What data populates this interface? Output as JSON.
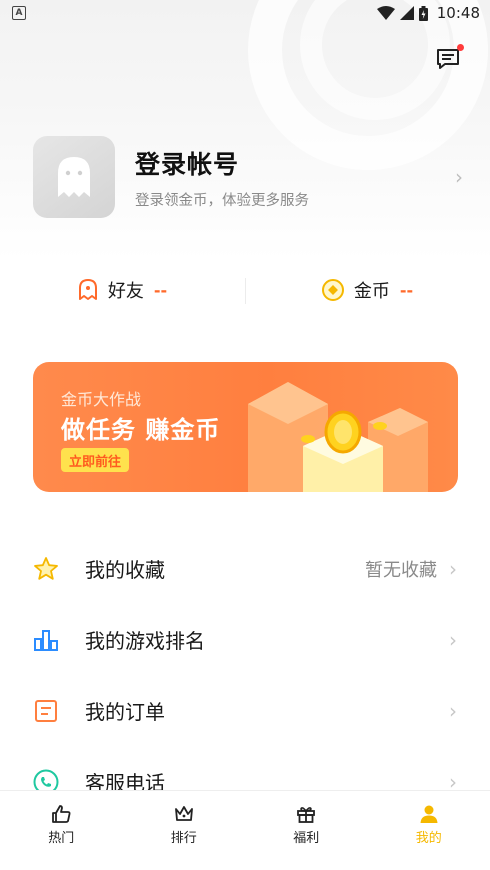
{
  "status_bar": {
    "time": "10:48",
    "badge": "A"
  },
  "profile": {
    "title": "登录帐号",
    "subtitle": "登录领金币，体验更多服务"
  },
  "stats": [
    {
      "label": "好友",
      "value": "--",
      "icon": "ghost-friend-icon"
    },
    {
      "label": "金币",
      "value": "--",
      "icon": "coin-icon"
    }
  ],
  "banner": {
    "small": "金币大作战",
    "big": "做任务 赚金币",
    "button": "立即前往"
  },
  "menu": [
    {
      "label": "我的收藏",
      "right": "暂无收藏",
      "icon": "star-icon"
    },
    {
      "label": "我的游戏排名",
      "right": "",
      "icon": "bar-chart-icon"
    },
    {
      "label": "我的订单",
      "right": "",
      "icon": "order-icon"
    },
    {
      "label": "客服电话",
      "right": "",
      "icon": "phone-icon"
    }
  ],
  "nav": [
    {
      "label": "热门",
      "icon": "thumbs-up-icon",
      "active": false
    },
    {
      "label": "排行",
      "icon": "crown-icon",
      "active": false
    },
    {
      "label": "福利",
      "icon": "gift-icon",
      "active": false
    },
    {
      "label": "我的",
      "icon": "user-icon",
      "active": true
    }
  ],
  "colors": {
    "accent": "#ff7f3f",
    "active_nav": "#f5b800",
    "stat_value": "#ff6a2b"
  }
}
